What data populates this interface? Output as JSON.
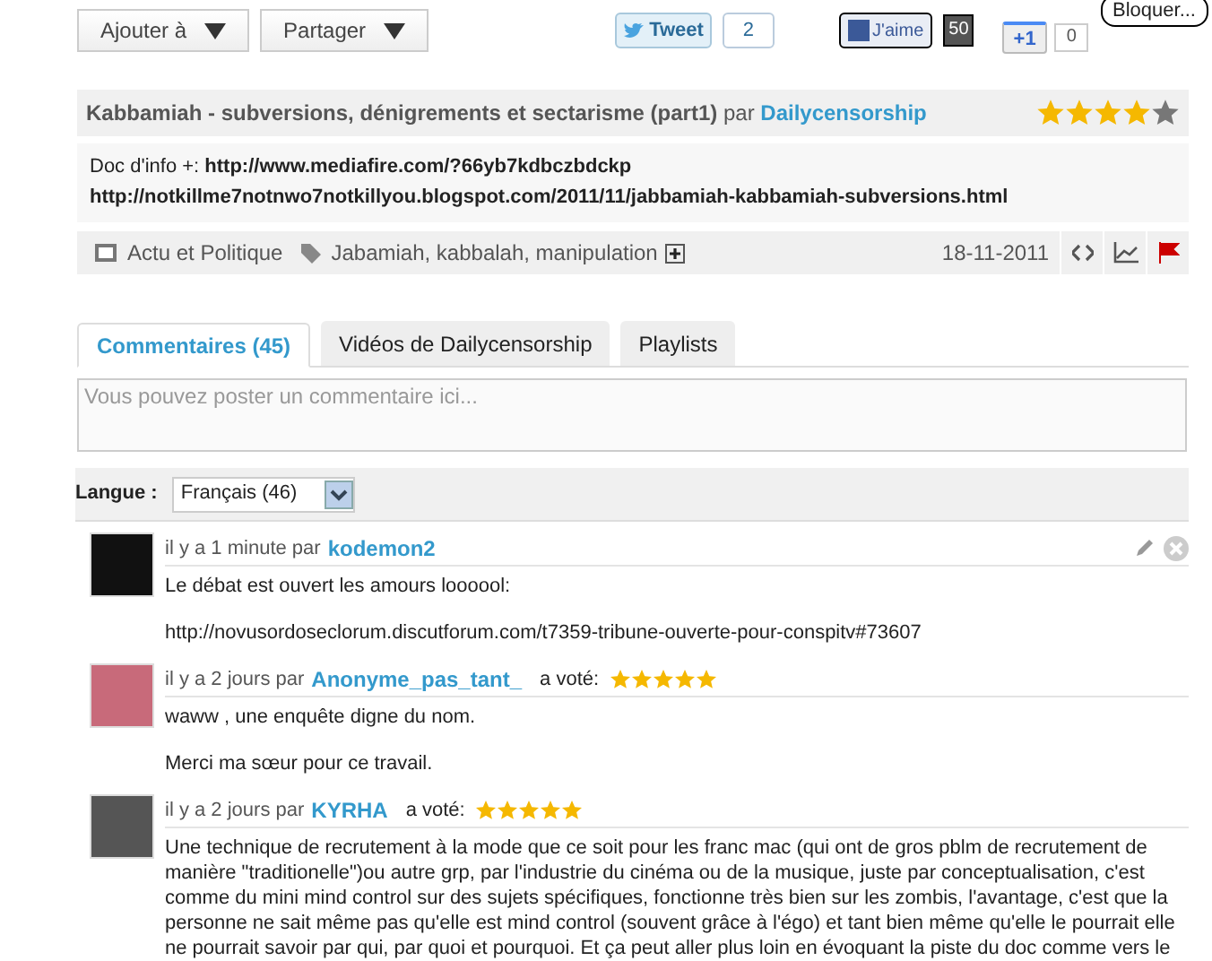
{
  "toolbar": {
    "buttons": [
      {
        "label": "Ajouter à"
      },
      {
        "label": "Partager"
      }
    ],
    "tweet": {
      "label": "Tweet",
      "count": "2"
    },
    "facebook": {
      "label": "J'aime",
      "count": "50"
    },
    "plusone": {
      "label": "+1",
      "count": "0"
    },
    "tooltip": "Bloquer..."
  },
  "video": {
    "title": "Kabbamiah - subversions, dénigrements et sectarisme (part1)",
    "by": "par",
    "author": "Dailycensorship",
    "stars": 4,
    "description": [
      "Doc d'info +: **http://www.mediafire.com/?66yb7kdbczbdckp**",
      "**http://notkillme7notnwo7notkillyou.blogspot.com/2011/11/jabbamiah-kabbamiah-subversions.html**"
    ],
    "category": "Actu et Politique",
    "tags": "Jabamiah, kabbalah, manipulation",
    "date": "18-11-2011"
  },
  "tabs": [
    {
      "label": "Commentaires (45)",
      "selected": true
    },
    {
      "label": "Vidéos de Dailycensorship",
      "selected": false
    },
    {
      "label": "Playlists",
      "selected": false
    }
  ],
  "comment_box": {
    "placeholder": "Vous pouvez poster un commentaire ici..."
  },
  "language": {
    "label": "Langue :",
    "value": "Français (46)"
  },
  "comments": [
    {
      "meta": "il y a 1 minute par",
      "author": "kodemon2",
      "own": true,
      "paragraphs": [
        "Le débat est ouvert les amours loooool:",
        "http://novusordoseclorum.discutforum.com/t7359-tribune-ouverte-pour-conspitv#73607"
      ]
    },
    {
      "meta": "il y a 2 jours par",
      "author": "Anonyme_pas_tant_",
      "own": false,
      "voted": "a voté:",
      "stars": 5,
      "paragraphs": [
        "waww , une enquête digne du nom.",
        "Merci ma sœur pour ce travail."
      ]
    },
    {
      "meta": "il y a 2 jours par",
      "author": "KYRHA",
      "own": false,
      "voted": "a voté:",
      "stars": 5,
      "paragraphs": [
        "Une technique de recrutement à la mode que ce soit pour les franc mac (qui ont de gros pblm de recrutement de manière \"traditionelle\")ou autre grp, par l'industrie du cinéma ou de la musique, juste par conceptualisation, c'est comme du mini mind control sur des sujets spécifiques, fonctionne très bien sur les zombis, l'avantage, c'est que la personne ne sait même pas qu'elle est mind control (souvent grâce à l'égo) et tant bien même qu'elle le pourrait elle ne pourrait savoir par qui, par quoi et pourquoi. Et ça peut aller plus loin en évoquant la piste du doc comme vers le"
      ]
    }
  ]
}
